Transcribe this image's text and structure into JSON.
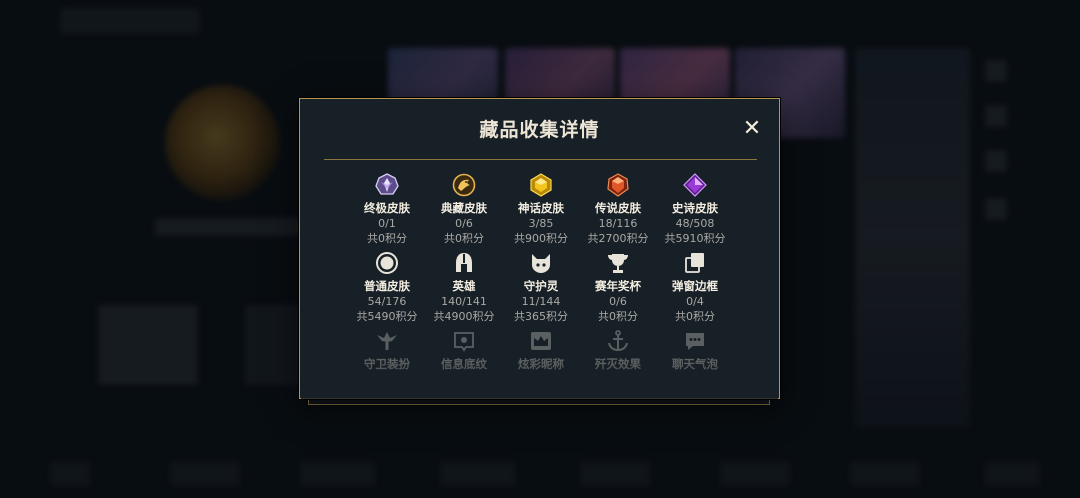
{
  "modal": {
    "title": "藏品收集详情",
    "close_label": "✕"
  },
  "collections": [
    {
      "icon": "ultimate-skin-icon",
      "name": "终极皮肤",
      "count": "0/1",
      "points": "共0积分"
    },
    {
      "icon": "prestige-skin-icon",
      "name": "典藏皮肤",
      "count": "0/6",
      "points": "共0积分"
    },
    {
      "icon": "mythic-skin-icon",
      "name": "神话皮肤",
      "count": "3/85",
      "points": "共900积分"
    },
    {
      "icon": "legendary-skin-icon",
      "name": "传说皮肤",
      "count": "18/116",
      "points": "共2700积分"
    },
    {
      "icon": "epic-skin-icon",
      "name": "史诗皮肤",
      "count": "48/508",
      "points": "共5910积分"
    },
    {
      "icon": "standard-skin-icon",
      "name": "普通皮肤",
      "count": "54/176",
      "points": "共5490积分"
    },
    {
      "icon": "champion-helmet-icon",
      "name": "英雄",
      "count": "140/141",
      "points": "共4900积分"
    },
    {
      "icon": "ward-cat-icon",
      "name": "守护灵",
      "count": "11/144",
      "points": "共365积分"
    },
    {
      "icon": "trophy-icon",
      "name": "赛年奖杯",
      "count": "0/6",
      "points": "共0积分"
    },
    {
      "icon": "frame-icon",
      "name": "弹窗边框",
      "count": "0/4",
      "points": "共0积分"
    },
    {
      "icon": "ward-skin-icon",
      "name": "守卫装扮"
    },
    {
      "icon": "banner-icon",
      "name": "信息底纹"
    },
    {
      "icon": "crown-icon",
      "name": "炫彩昵称"
    },
    {
      "icon": "anchor-icon",
      "name": "歼灭效果"
    },
    {
      "icon": "chat-bubble-icon",
      "name": "聊天气泡"
    }
  ],
  "colors": {
    "gold_border": "#b7974f",
    "panel_bg": "#172027",
    "text_primary": "#f3ede0",
    "text_secondary": "#a9a9a5",
    "mythic_gold": "#e7b21a",
    "legendary_orange": "#e0582a",
    "epic_purple": "#9b3bd6",
    "ultimate_lavender": "#b9a3e8"
  }
}
